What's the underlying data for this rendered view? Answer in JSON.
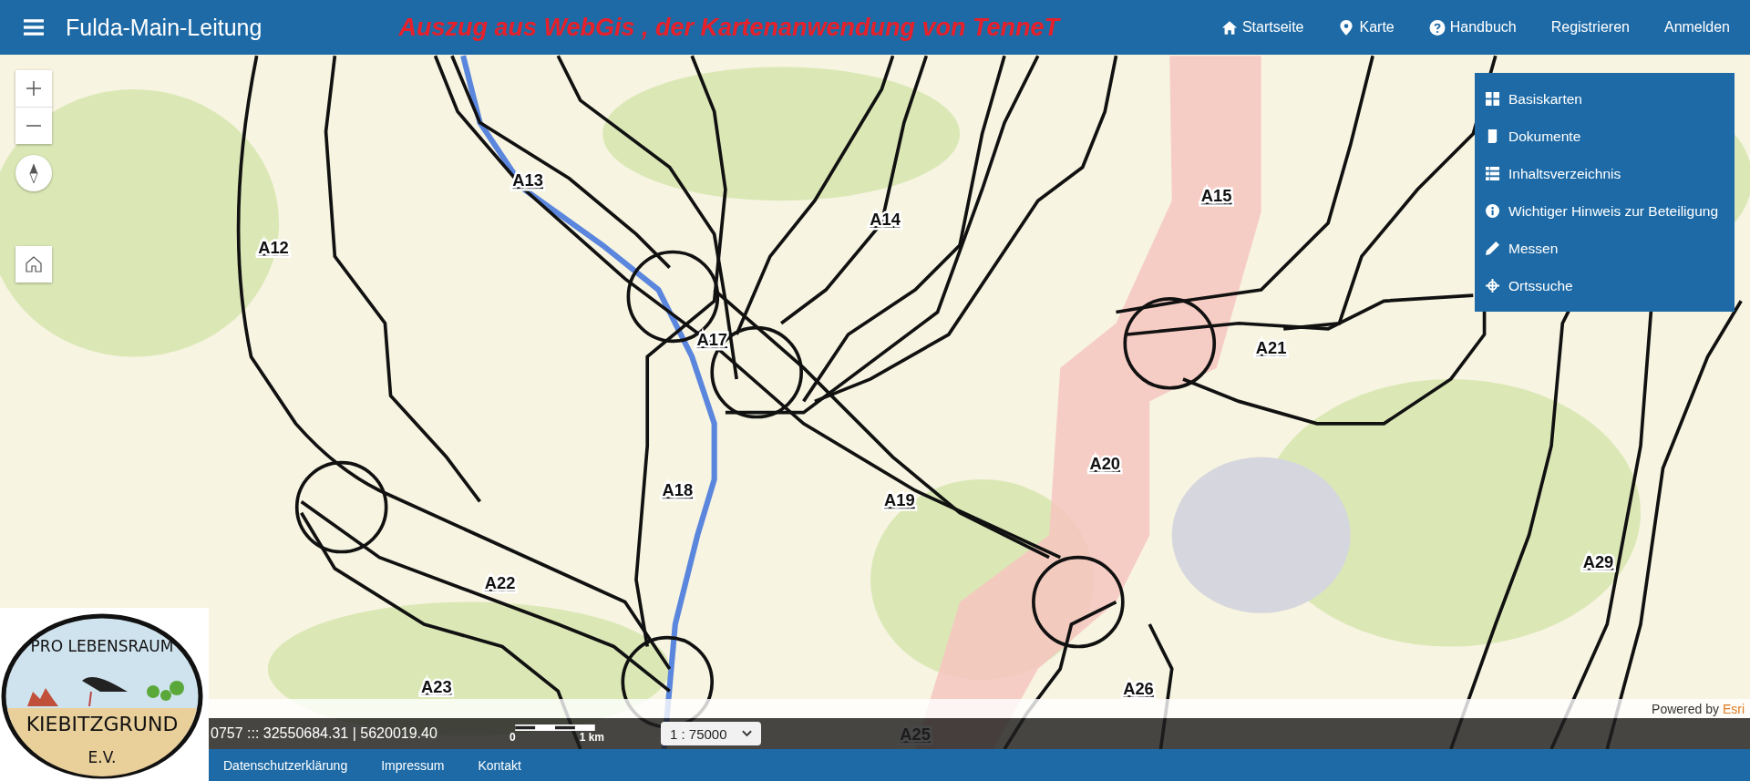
{
  "header": {
    "title": "Fulda-Main-Leitung",
    "banner": "Auszug aus WebGis , der Kartenanwendung von TenneT",
    "nav": [
      "Startseite",
      "Karte",
      "Handbuch",
      "Registrieren",
      "Anmelden"
    ]
  },
  "map": {
    "corridor_labels": [
      "A12",
      "A13",
      "A14",
      "A15",
      "A17",
      "A18",
      "A19",
      "A20",
      "A21",
      "A22",
      "A23",
      "A25",
      "A26",
      "A29"
    ],
    "attribution": {
      "prefix": "Powered by",
      "brand": "Esri"
    },
    "coordinates": "0757 ::: 32550684.31 | 5620019.40",
    "scale_bar": {
      "start": "0",
      "end": "1 km"
    },
    "scale_select": {
      "value": "1 : 75000"
    }
  },
  "menu": [
    "Basiskarten",
    "Dokumente",
    "Inhaltsverzeichnis",
    "Wichtiger Hinweis zur Beteiligung",
    "Messen",
    "Ortssuche"
  ],
  "logo": {
    "top": "PRO LEBENSRAUM",
    "name": "KIEBITZGRUND",
    "suffix": "E.V."
  },
  "footer": {
    "links": [
      "Datenschutzerklärung",
      "Impressum",
      "Kontakt"
    ]
  }
}
